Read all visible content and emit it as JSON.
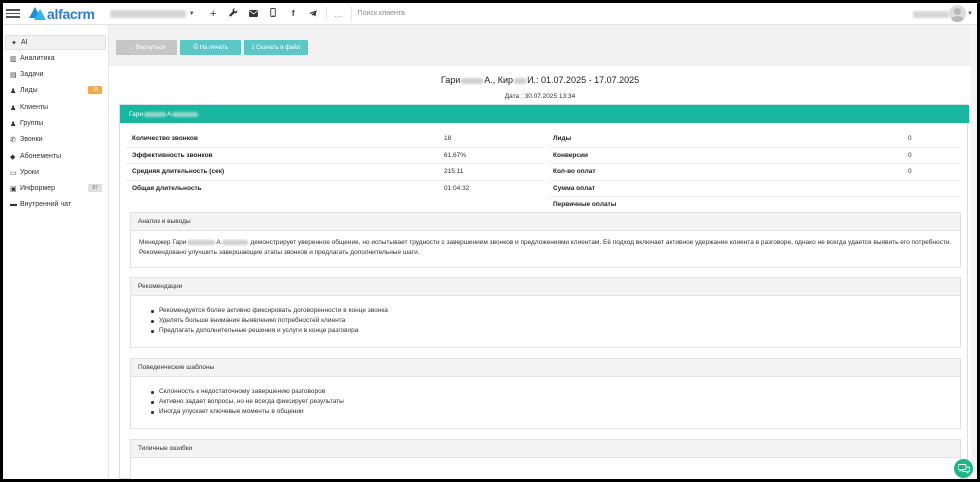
{
  "app": {
    "logo_text": "alfacrm",
    "search_placeholder": "Поиск клиента"
  },
  "toolbar": {
    "icons": [
      "plus-icon",
      "wrench-icon",
      "mail-icon",
      "phone-icon",
      "facebook-icon",
      "telegram-icon",
      "more-icon"
    ]
  },
  "sidebar": {
    "items": [
      {
        "label": "AI",
        "icon": "ai-icon"
      },
      {
        "label": "Аналитика",
        "icon": "analytics-icon"
      },
      {
        "label": "Задачи",
        "icon": "tasks-icon"
      },
      {
        "label": "Лиды",
        "icon": "leads-icon",
        "badge": "18"
      },
      {
        "label": "Клиенты",
        "icon": "clients-icon"
      },
      {
        "label": "Группы",
        "icon": "groups-icon"
      },
      {
        "label": "Звонки",
        "icon": "calls-icon"
      },
      {
        "label": "Абонементы",
        "icon": "subscriptions-icon"
      },
      {
        "label": "Уроки",
        "icon": "lessons-icon"
      },
      {
        "label": "Информер",
        "icon": "informer-icon",
        "badge": "87"
      },
      {
        "label": "Внутренний чат",
        "icon": "chat-icon"
      }
    ]
  },
  "actions": {
    "back": "Вернуться",
    "print": "На печать",
    "download": "Скачать в файл"
  },
  "report": {
    "title_a": "Гари",
    "title_b": "А., Кир",
    "title_c": "И.: 01.07.2025 - 17.07.2025",
    "date": "Дата : 30.07.2025 13:34",
    "card_title_a": "Гари",
    "card_title_b": "А",
    "stats_left": [
      {
        "label": "Количество звонков",
        "value": "18"
      },
      {
        "label": "Эффективность звонков",
        "value": "61.67%"
      },
      {
        "label": "Средняя длительность (сек)",
        "value": "215.11"
      },
      {
        "label": "Общая длительность",
        "value": "01:04:32"
      }
    ],
    "stats_right": [
      {
        "label": "Лиды",
        "value": "0"
      },
      {
        "label": "Конверсии",
        "value": "0"
      },
      {
        "label": "Кол-во оплат",
        "value": "0"
      },
      {
        "label": "Сумма оплат",
        "value": ""
      },
      {
        "label": "Первичные оплаты",
        "value": ""
      }
    ],
    "analysis": {
      "heading": "Анализ и выводы",
      "text_a": "Менеджер Гари",
      "text_b": "А",
      "text_c": "демонстрирует уверенное общение, но испытывает трудности с завершением звонков и предложениями клиентам. Её подход включает активное удержание клиента в разговоре, однако не всегда удается выявить его потребности. Рекомендовано улучшить завершающие этапы звонков и предлагать дополнительные шаги."
    },
    "recommendations": {
      "heading": "Рекомендации",
      "items": [
        "Рекомендуется более активно фиксировать договоренности в конце звонка",
        "Уделять больше внимания выявлению потребностей клиента",
        "Предлагать дополнительные решения и услуги в конце разговора"
      ]
    },
    "patterns": {
      "heading": "Поведенческие шаблоны",
      "items": [
        "Склонность к недостаточному завершению разговоров",
        "Активно задает вопросы, но не всегда фиксирует результаты",
        "Иногда упускает ключевые моменты в общении"
      ]
    },
    "mistakes": {
      "heading": "Типичные ошибки"
    }
  },
  "colors": {
    "card_header": "#1bb6a0",
    "button_teal": "#5cc7c7",
    "button_gray": "#c6c6c6",
    "badge_orange": "#f7a64a",
    "chat_fab": "#1db583",
    "logo": "#2a7fc9"
  }
}
